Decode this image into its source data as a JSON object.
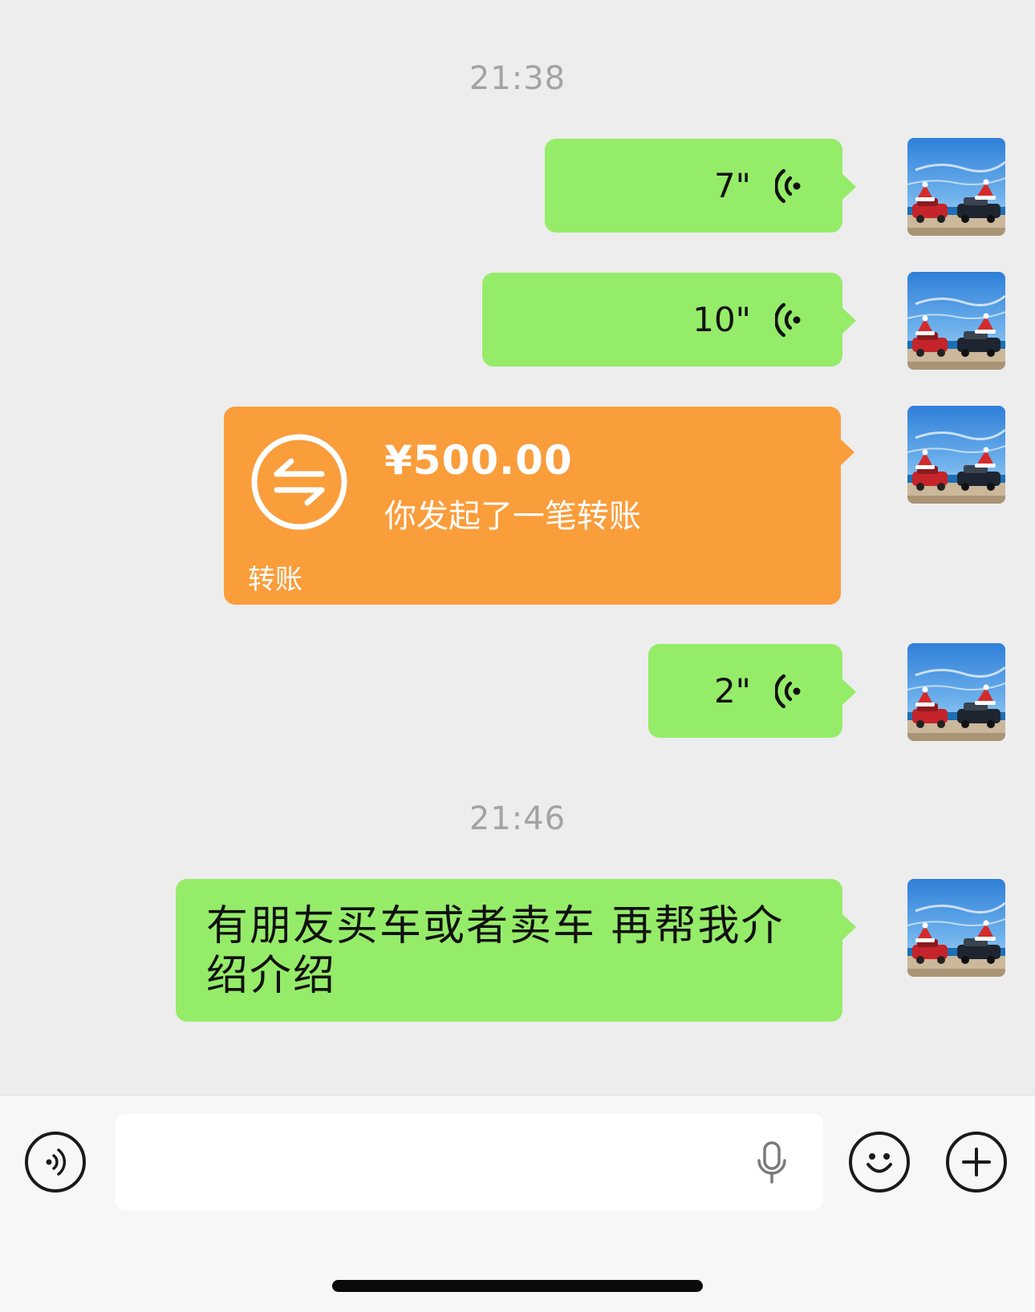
{
  "timestamps": [
    "21:38",
    "21:46"
  ],
  "messages": {
    "voice1": {
      "duration": "7\""
    },
    "voice2": {
      "duration": "10\""
    },
    "transfer": {
      "amount": "¥500.00",
      "description": "你发起了一笔转账",
      "label": "转账"
    },
    "voice3": {
      "duration": "2\""
    },
    "text1": {
      "text": "有朋友买车或者卖车 再帮我介绍介绍"
    }
  },
  "colors": {
    "chat_bg": "#ededed",
    "bubble_green": "#95ec69",
    "bubble_orange": "#fa9d3b",
    "timestamp": "#a3a3a3",
    "input_bar_bg": "#f7f7f7"
  },
  "input_bar": {
    "voice_toggle_icon": "voice-toggle-icon",
    "mic_icon": "microphone-icon",
    "emoji_icon": "emoji-smile-icon",
    "more_icon": "plus-circle-icon"
  }
}
